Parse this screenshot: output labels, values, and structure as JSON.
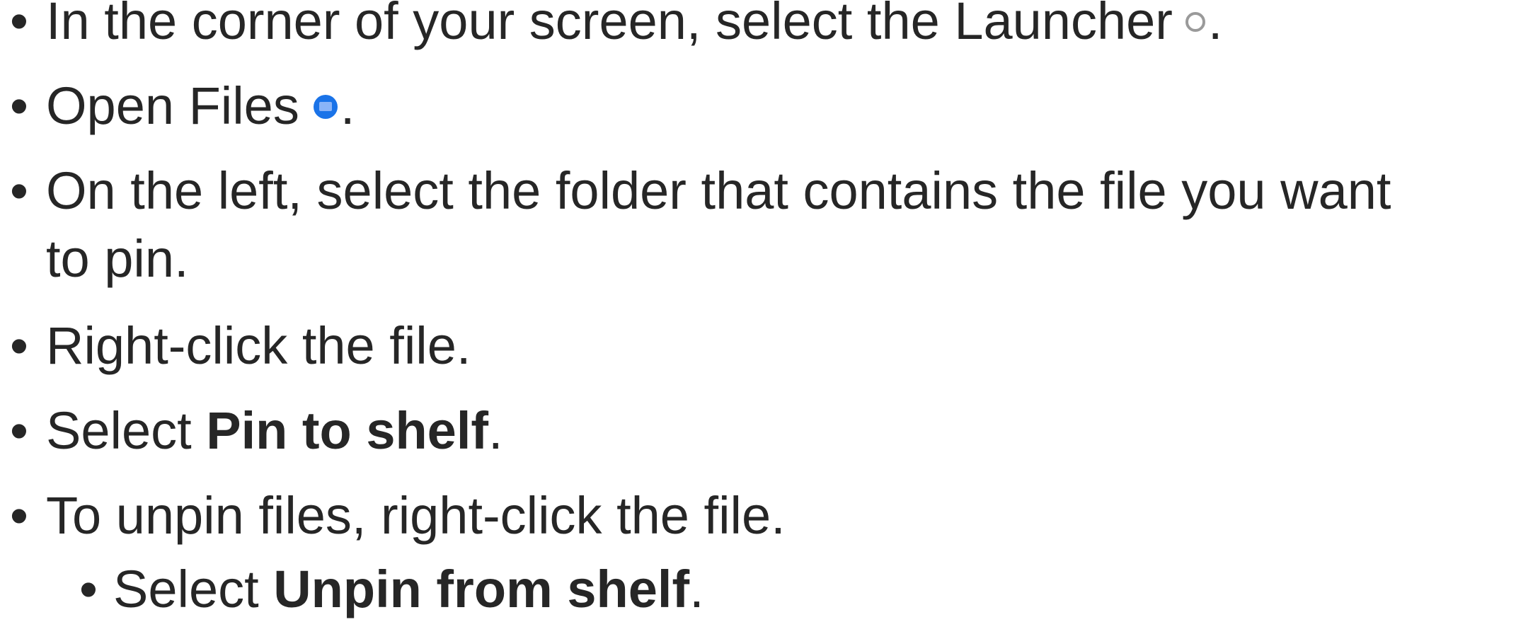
{
  "bullet_glyph": "•",
  "steps": [
    {
      "before": "In the corner of your screen, select the Launcher",
      "icon": "launcher-icon",
      "after": "."
    },
    {
      "before": "Open Files",
      "icon": "files-icon",
      "after": "."
    },
    {
      "line1": "On the left, select the folder that contains the file you want",
      "line2": "to pin."
    },
    {
      "text": "Right-click the file."
    },
    {
      "before": "Select ",
      "bold": "Pin to shelf",
      "after": "."
    },
    {
      "text": "To unpin files, right-click the file."
    },
    {
      "before": "Select ",
      "bold": "Unpin from shelf",
      "after": "."
    }
  ]
}
